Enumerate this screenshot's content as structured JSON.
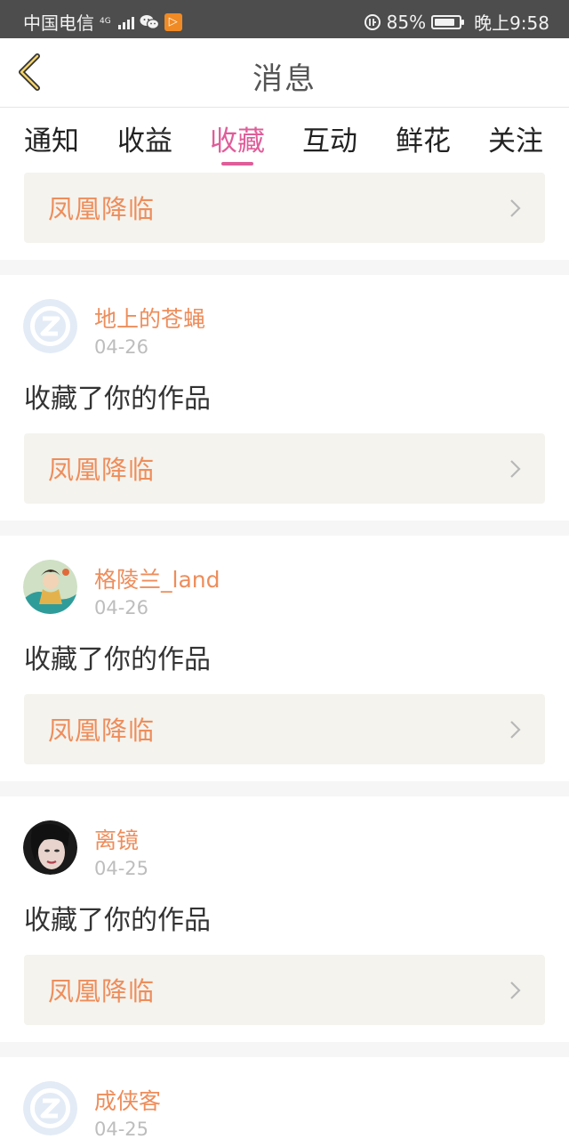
{
  "status_bar": {
    "carrier": "中国电信",
    "network": "4G",
    "battery": "85%",
    "battery_level": 0.85,
    "time": "晚上9:58"
  },
  "header": {
    "title": "消息",
    "back_icon": "chevron-left-icon"
  },
  "tabs": [
    {
      "label": "通知",
      "active": false
    },
    {
      "label": "收益",
      "active": false
    },
    {
      "label": "收藏",
      "active": true
    },
    {
      "label": "互动",
      "active": false
    },
    {
      "label": "鲜花",
      "active": false
    },
    {
      "label": "关注",
      "active": false
    }
  ],
  "colors": {
    "accent": "#e05d9a",
    "orange": "#ee8d5b",
    "work_bg": "#f4f3ee"
  },
  "top_partial": {
    "work_title": "凤凰降临"
  },
  "items": [
    {
      "username": "地上的苍蝇",
      "date": "04-26",
      "action": "收藏了你的作品",
      "work_title": "凤凰降临",
      "avatar": "default-avatar"
    },
    {
      "username": "格陵兰_land",
      "date": "04-26",
      "action": "收藏了你的作品",
      "work_title": "凤凰降临",
      "avatar": "illustrated-avatar"
    },
    {
      "username": "离镜",
      "date": "04-25",
      "action": "收藏了你的作品",
      "work_title": "凤凰降临",
      "avatar": "photo-avatar"
    },
    {
      "username": "成侠客",
      "date": "04-25",
      "action": "",
      "work_title": "",
      "avatar": "default-avatar"
    }
  ]
}
